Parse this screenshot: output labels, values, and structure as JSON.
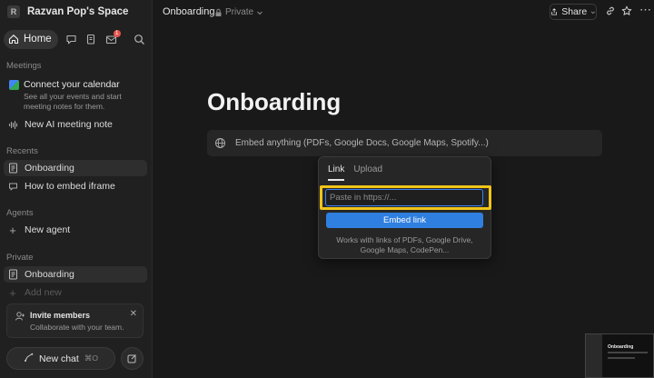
{
  "workspace": {
    "badge": "R",
    "name": "Razvan Pop's Space"
  },
  "nav": {
    "home_label": "Home",
    "notification_count": "1"
  },
  "meetings": {
    "section_label": "Meetings",
    "calendar_title": "Connect your calendar",
    "calendar_desc": "See all your events and start meeting notes for them.",
    "new_note_label": "New AI meeting note"
  },
  "recents": {
    "section_label": "Recents",
    "items": [
      {
        "label": "Onboarding"
      },
      {
        "label": "How to embed iframe"
      }
    ]
  },
  "agents": {
    "section_label": "Agents",
    "new_agent_label": "New agent"
  },
  "private": {
    "section_label": "Private",
    "items": [
      {
        "label": "Onboarding"
      }
    ],
    "add_new_label": "Add new"
  },
  "invite": {
    "title": "Invite members",
    "subtitle": "Collaborate with your team."
  },
  "new_chat": {
    "label": "New chat",
    "shortcut": "⌘O"
  },
  "topbar": {
    "breadcrumb": "Onboarding",
    "privacy": "Private",
    "share_label": "Share"
  },
  "page": {
    "title": "Onboarding"
  },
  "embed": {
    "placeholder_text": "Embed anything (PDFs, Google Docs, Google Maps, Spotify...)"
  },
  "popup": {
    "tabs": [
      "Link",
      "Upload"
    ],
    "input_placeholder": "Paste in https://...",
    "input_value": "",
    "button_label": "Embed link",
    "help_text": "Works with links of PDFs, Google Drive, Google Maps, CodePen..."
  },
  "thumbnail": {
    "title": "Onboarding"
  },
  "colors": {
    "accent": "#2f7fe0",
    "highlight": "#f0c419",
    "notification": "#e5534b"
  }
}
